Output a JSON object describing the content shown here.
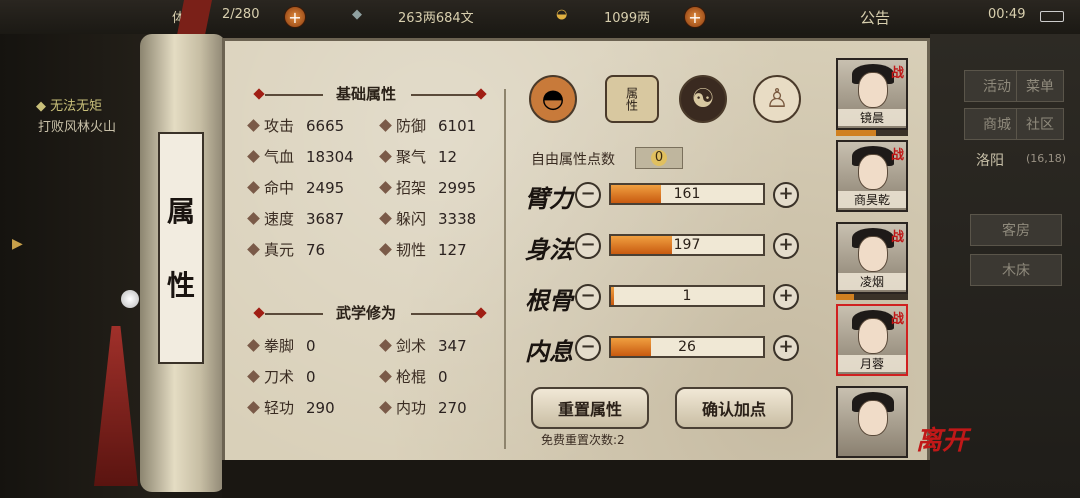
{
  "topbar": {
    "stamina_label": "体力",
    "stamina": "2/280",
    "money": "263两684文",
    "gold": "1099两",
    "notice": "公告",
    "time": "00:49"
  },
  "quest": {
    "title": "无法无矩",
    "subtitle": "打败风林火山"
  },
  "right_menu": {
    "buttons": [
      "活动",
      "菜单",
      "商城",
      "社区"
    ],
    "location": "洛阳",
    "coords": "(16,18)",
    "rooms": [
      "客房",
      "木床"
    ]
  },
  "scroll_title": [
    "属",
    "性"
  ],
  "basic": {
    "title": "基础属性",
    "stats": [
      {
        "label": "攻击",
        "value": "6665"
      },
      {
        "label": "防御",
        "value": "6101"
      },
      {
        "label": "气血",
        "value": "18304"
      },
      {
        "label": "聚气",
        "value": "12"
      },
      {
        "label": "命中",
        "value": "2495"
      },
      {
        "label": "招架",
        "value": "2995"
      },
      {
        "label": "速度",
        "value": "3687"
      },
      {
        "label": "躲闪",
        "value": "3338"
      },
      {
        "label": "真元",
        "value": "76"
      },
      {
        "label": "韧性",
        "value": "127"
      }
    ]
  },
  "martial": {
    "title": "武学修为",
    "stats": [
      {
        "label": "拳脚",
        "value": "0"
      },
      {
        "label": "剑术",
        "value": "347"
      },
      {
        "label": "刀术",
        "value": "0"
      },
      {
        "label": "枪棍",
        "value": "0"
      },
      {
        "label": "轻功",
        "value": "290"
      },
      {
        "label": "内功",
        "value": "270"
      }
    ]
  },
  "tabs": {
    "active_label": "属性"
  },
  "free_points": {
    "label": "自由属性点数",
    "value": "0"
  },
  "attributes": [
    {
      "name": "臂力",
      "value": "161",
      "fill": 0.33
    },
    {
      "name": "身法",
      "value": "197",
      "fill": 0.4
    },
    {
      "name": "根骨",
      "value": "1",
      "fill": 0.02
    },
    {
      "name": "内息",
      "value": "26",
      "fill": 0.26
    }
  ],
  "actions": {
    "reset": "重置属性",
    "confirm": "确认加点",
    "reset_note": "免费重置次数:2"
  },
  "roster": [
    {
      "name": "镜晨",
      "badge": "战",
      "hp": 0.55
    },
    {
      "name": "商昊乾",
      "badge": "战",
      "hp": null
    },
    {
      "name": "凌烟",
      "badge": "战",
      "hp": 0.25
    },
    {
      "name": "月蓉",
      "badge": "战",
      "hp": null
    },
    {
      "name": "",
      "badge": "",
      "hp": null
    }
  ],
  "leave": "离开"
}
